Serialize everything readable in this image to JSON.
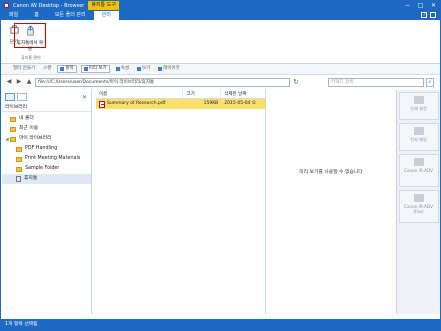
{
  "window": {
    "title": "Canon iW Desktop - Browser",
    "context_tab_group": "휴지통 도구",
    "controls": [
      "−",
      "□",
      "✕"
    ]
  },
  "ribbon_tabs": [
    "파일",
    "홈",
    "모든 폴더 관리",
    "관리"
  ],
  "ribbon_right_icons": [
    "?"
  ],
  "ribbon": {
    "close_label": "닫기",
    "restore_label": "휴지통에서 복원",
    "group_label": "휴지통 관리"
  },
  "toolbar": {
    "items": [
      "필터 만들기",
      "스캔",
      "항목",
      "미리 보기",
      "속성",
      "보기",
      "레이아웃"
    ]
  },
  "address": {
    "path": "file:///C:/Users/user/Documents/마이 라이브러리/휴지통",
    "search_placeholder": "키워드 검색"
  },
  "nav_pane": {
    "title": "라이브러리",
    "tree": [
      {
        "label": "내 폴더",
        "depth": 1
      },
      {
        "label": "최근 이용",
        "depth": 1
      },
      {
        "label": "마이 라이브러리",
        "depth": 0
      },
      {
        "label": "PDF Handling",
        "depth": 1
      },
      {
        "label": "Print Meeting Materials",
        "depth": 1
      },
      {
        "label": "Sample Folder",
        "depth": 1
      },
      {
        "label": "휴지통",
        "depth": 1
      }
    ]
  },
  "file_list": {
    "headers": {
      "name": "이름",
      "size": "크기",
      "date": "삭제된 날짜"
    },
    "rows": [
      {
        "name": "Summary of Research.pdf",
        "size": "159KB",
        "date": "2015-05-04 오"
      }
    ]
  },
  "preview": {
    "message": "미리 보기를 사용할 수 없습니다"
  },
  "actions": [
    {
      "label": "인쇄 설정"
    },
    {
      "label": "전자 메일"
    },
    {
      "label": "Canon iR-ADV"
    },
    {
      "label": "Canon iR-ADV (Fax)"
    }
  ],
  "status": {
    "text": "1개 항목 선택됨"
  },
  "colors": {
    "accent": "#1e6ac2",
    "highlight_row": "#f8e06a",
    "context_tab": "#f2c200",
    "focus_box": "#d40000"
  }
}
